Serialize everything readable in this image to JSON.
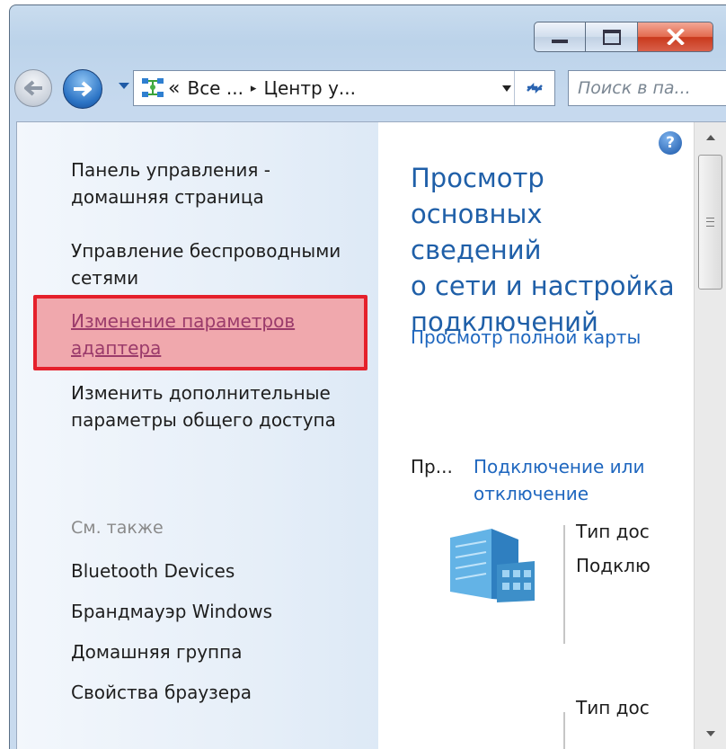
{
  "window": {
    "caption_buttons": [
      "minimize",
      "maximize",
      "close"
    ]
  },
  "navbar": {
    "address_parts": [
      "«",
      "Все ...",
      "▸",
      "Центр у..."
    ],
    "search_placeholder": "Поиск в па..."
  },
  "left_pane": {
    "items": [
      "Панель управления -",
      "домашняя страница",
      "Управление беспроводными",
      "сетями",
      "Изменение параметров",
      "адаптера",
      "Изменить дополнительные",
      "параметры общего доступа"
    ],
    "see_also_label": "См. также",
    "see_also_items": [
      "Bluetooth Devices",
      "Брандмауэр Windows",
      "Домашняя группа",
      "Свойства браузера"
    ]
  },
  "right_pane": {
    "title_lines": [
      "Просмотр",
      "основных сведений",
      "о сети и настройка",
      "подключений"
    ],
    "full_map_link": "Просмотр полной карты",
    "truncated_label": "Пр...",
    "connect_link_lines": [
      "Подключение или",
      "отключение"
    ],
    "access_type": "Тип дос",
    "connections": "Подклю",
    "access_type_2": "Тип дос"
  },
  "colors": {
    "highlight_border": "#e5202b",
    "link_blue": "#1f67bf",
    "title_blue": "#1f5fa8"
  }
}
